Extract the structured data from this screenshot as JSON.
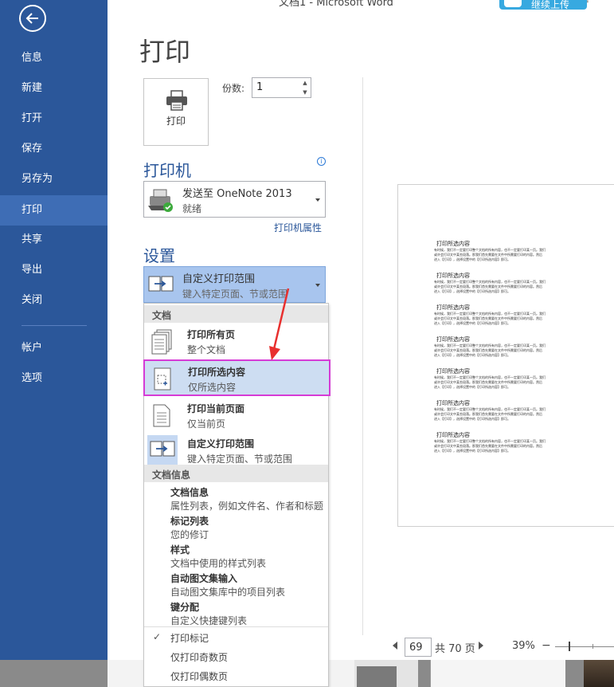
{
  "window": {
    "title": "文档1 - Microsoft Word",
    "signin": "继续上传",
    "more": "?"
  },
  "nav": {
    "back_label": "返回",
    "items": [
      {
        "label": "信息"
      },
      {
        "label": "新建"
      },
      {
        "label": "打开"
      },
      {
        "label": "保存"
      },
      {
        "label": "另存为"
      },
      {
        "label": "打印"
      },
      {
        "label": "共享"
      },
      {
        "label": "导出"
      },
      {
        "label": "关闭"
      },
      {
        "label": "帐户"
      },
      {
        "label": "选项"
      }
    ],
    "active": "打印"
  },
  "print": {
    "page_title": "打印",
    "print_button": "打印",
    "copies_label": "份数:",
    "copies_value": "1"
  },
  "printer": {
    "section_title": "打印机",
    "info_icon": "i",
    "name": "发送至 OneNote 2013",
    "status": "就绪",
    "properties_link": "打印机属性"
  },
  "settings": {
    "section_title": "设置",
    "range_name": "自定义打印范围",
    "range_desc": "键入特定页面、节或范围"
  },
  "dropdown": {
    "group_document": "文档",
    "options": [
      {
        "title": "打印所有页",
        "desc": "整个文档"
      },
      {
        "title": "打印所选内容",
        "desc": "仅所选内容"
      },
      {
        "title": "打印当前页面",
        "desc": "仅当前页"
      },
      {
        "title": "自定义打印范围",
        "desc": "键入特定页面、节或范围"
      }
    ],
    "group_info": "文档信息",
    "info_items": [
      {
        "title": "文档信息",
        "desc": "属性列表，例如文件名、作者和标题"
      },
      {
        "title": "标记列表",
        "desc": "您的修订"
      },
      {
        "title": "样式",
        "desc": "文档中使用的样式列表"
      },
      {
        "title": "自动图文集输入",
        "desc": "自动图文集库中的项目列表"
      },
      {
        "title": "键分配",
        "desc": "自定义快捷键列表"
      }
    ],
    "check_items": [
      {
        "label": "打印标记",
        "checked": true,
        "mark": "✓"
      },
      {
        "label": "仅打印奇数页",
        "checked": false,
        "mark": ""
      },
      {
        "label": "仅打印偶数页",
        "checked": false,
        "mark": ""
      }
    ]
  },
  "preview": {
    "heading": "打印所选内容",
    "body_lines": [
      "有时候，我们不一定要打印整个文档的所有内容，也不一定要打印某一页。我们",
      "或许会打印文中某些段落。那我们首先需要在文件中所需要打印的内容。然后",
      "进入【打印】，选择设置中的【打印所选内容】即可。"
    ],
    "block_count": 7
  },
  "pager": {
    "current": "69",
    "total": "共 70 页"
  },
  "zoom": {
    "level": "39%",
    "minus": "−"
  },
  "colors": {
    "nav_bg": "#2b579a",
    "nav_active": "#3e6db5",
    "highlight_border": "#d63bd6",
    "arrow": "#e8302f"
  }
}
